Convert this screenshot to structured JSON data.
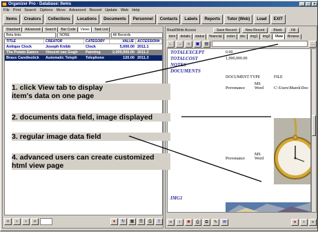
{
  "window": {
    "title": "Organizer Pro - Database: Items"
  },
  "menu": [
    "File",
    "Print",
    "Search",
    "Options",
    "Move",
    "Advanced",
    "Record",
    "Update",
    "Web",
    "Help"
  ],
  "toolbar": [
    "Items",
    "Creators",
    "Collections",
    "Locations",
    "Documents",
    "Personnel",
    "Contacts",
    "Labels",
    "Reports",
    "Tutor (Web)",
    "Load",
    "EXIT"
  ],
  "list_tabs": [
    "Standard",
    "Advanced",
    "Search",
    "Bar Code",
    "Views",
    "Task List"
  ],
  "filters": [
    "Beta links",
    "NONE",
    "All Records"
  ],
  "grid": {
    "columns": [
      "TITLE",
      "CREATOR",
      "CATEGORY",
      "VALUE",
      "ACCESSION#"
    ],
    "rows": [
      [
        "Antique Clock",
        "Joseph Knibb",
        "Clock",
        "5,000.00",
        "2011.1"
      ],
      [
        "The Potato Eaters",
        "Vincent van Gogh",
        "Painting",
        "2,000,000.00",
        "2011.2"
      ],
      [
        "Brass Candlestick",
        "Automatic Teleph",
        "Telephone",
        "120.00",
        "2011.3"
      ]
    ]
  },
  "record_panel": {
    "title": "Read/Write Access",
    "buttons": [
      "Save Record",
      "New Record",
      "Blank",
      "Fill"
    ],
    "tabs": [
      "item",
      "details",
      "status",
      "financial",
      "notes",
      "doc",
      "img1",
      "img2",
      "View",
      "Browse"
    ]
  },
  "view": {
    "fields": [
      {
        "label": "TOTALEXCEPT",
        "value": "0.00"
      },
      {
        "label": "TOTALCOST",
        "value": "1,900,000.00"
      },
      {
        "label": "NOTES",
        "value": ""
      },
      {
        "label": "DOCUMENTS",
        "value": ""
      }
    ],
    "doc_headers": [
      "DOCUMENT TYPE",
      "FILE"
    ],
    "docs": [
      {
        "name": "Provenance",
        "type": "MS Word",
        "file": "C:\\Users\\Marek\\Doc"
      },
      {
        "name": "Provenance",
        "type": "MS Word",
        "file": ""
      }
    ],
    "img_label": "IMG1"
  },
  "callouts": [
    "1. click View tab to display",
    "item's data on one page",
    "2. documents data field, image displayed",
    "3. regular image data field",
    "4. advanced users can create customized",
    "html view page"
  ]
}
